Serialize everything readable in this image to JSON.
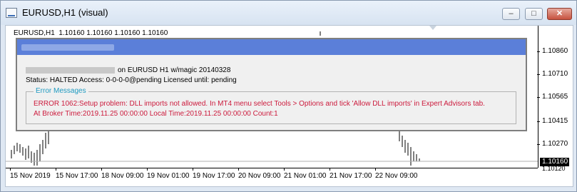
{
  "window": {
    "title": "EURUSD,H1 (visual)",
    "minimize_glyph": "–",
    "maximize_glyph": "□",
    "close_glyph": "✕"
  },
  "chart": {
    "symbol_line": "EURUSD,H1  1.10160 1.10160 1.10160 1.10160",
    "price_labels": [
      "1.10860",
      "1.10710",
      "1.10565",
      "1.10415",
      "1.10270",
      "1.10120"
    ],
    "current_price": "1.10160",
    "time_labels": [
      "15 Nov 2019",
      "15 Nov 17:00",
      "18 Nov 09:00",
      "19 Nov 01:00",
      "19 Nov 17:00",
      "20 Nov 09:00",
      "21 Nov 01:00",
      "21 Nov 17:00",
      "22 Nov 09:00"
    ]
  },
  "dialog": {
    "line1_suffix": "on EURUSD H1 w/magic 20140328",
    "line2": "Status: HALTED Access: 0-0-0-0@pending Licensed until: pending",
    "error_group_title": "Error Messages",
    "error_line1": "ERROR 1062:Setup problem: DLL imports not allowed. In MT4 menu select Tools > Options and tick 'Allow DLL imports' in Expert Advisors tab.",
    "error_line2": "At Broker Time:2019.11.25 00:00:00 Local Time:2019.11.25 00:00:00 Count:1"
  },
  "colors": {
    "dialog_header": "#5b7fd9",
    "error_text": "#cc1a3c",
    "group_title": "#1e9ac0"
  }
}
